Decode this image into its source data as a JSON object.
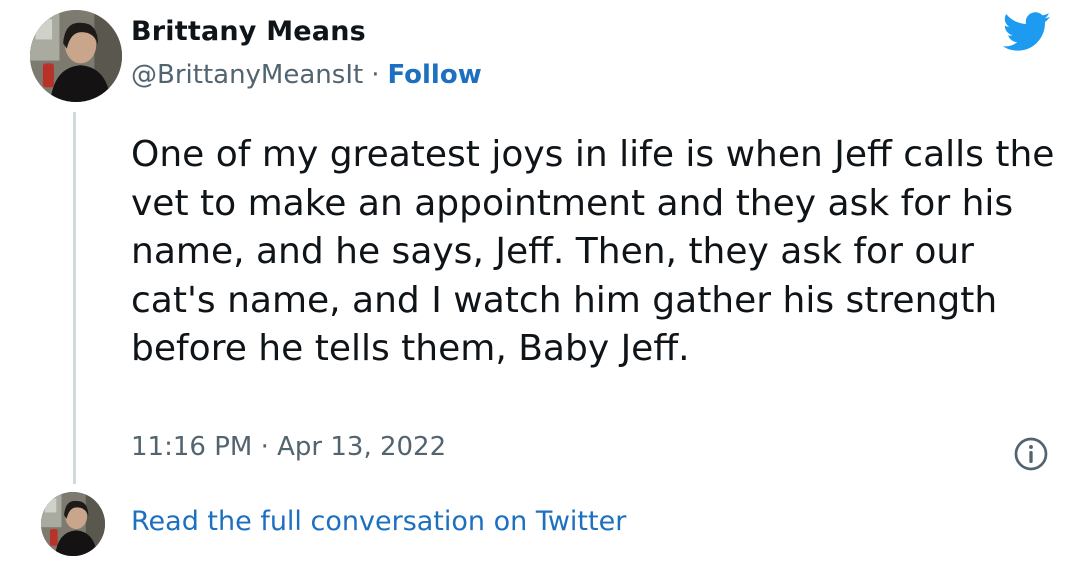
{
  "tweet": {
    "author_name": "Brittany Means",
    "handle": "@BrittanyMeansIt",
    "separator": "·",
    "follow_label": "Follow",
    "text": "One of my greatest joys in life is when Jeff calls the vet to make an appointment and they ask for his name, and he says, Jeff. Then, they ask for our cat's name, and I watch him gather his strength before he tells them, Baby Jeff.",
    "time": "11:16 PM",
    "date": "Apr 13, 2022"
  },
  "footer": {
    "read_label": "Read the full conversation on Twitter"
  },
  "icons": {
    "brand": "twitter-bird-icon",
    "info": "info-icon"
  },
  "colors": {
    "brand_blue": "#1d9bf0",
    "link_blue": "#1d6fbf",
    "text": "#0f1419",
    "muted": "#536471",
    "thread_line": "#cfd9de"
  }
}
